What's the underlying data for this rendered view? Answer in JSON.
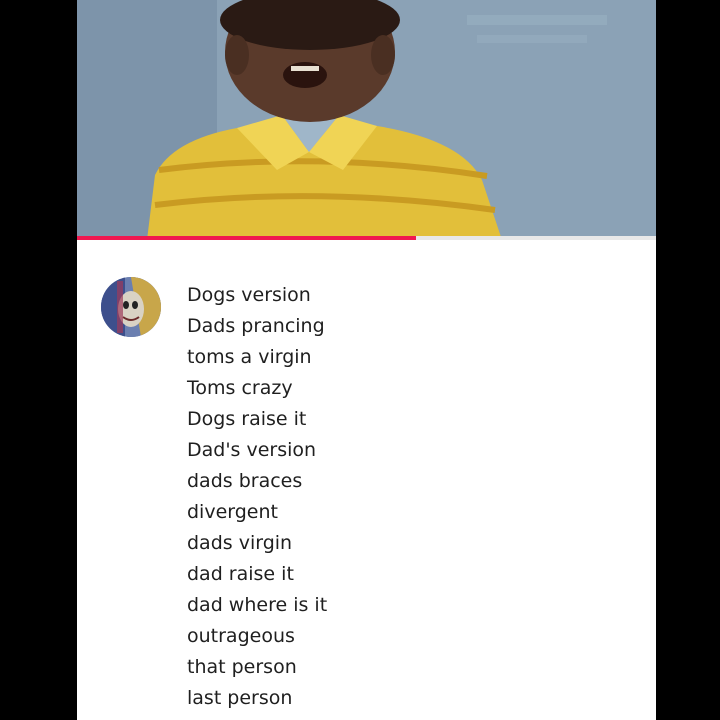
{
  "video": {
    "progress": 0.585
  },
  "comment": {
    "avatar_icon": "profile-avatar-icon",
    "lines": [
      "Dogs version",
      "Dads prancing",
      "toms a virgin",
      "Toms crazy",
      "Dogs raise it",
      "Dad's version",
      "dads braces",
      "divergent",
      "dads virgin",
      "dad raise it",
      "dad where is it",
      "outrageous",
      "that person",
      "last person"
    ]
  },
  "colors": {
    "progress_played": "#f01850",
    "progress_track": "#e8e8e8",
    "video_background": "#8aa4b8",
    "letterbox": "#000000"
  }
}
